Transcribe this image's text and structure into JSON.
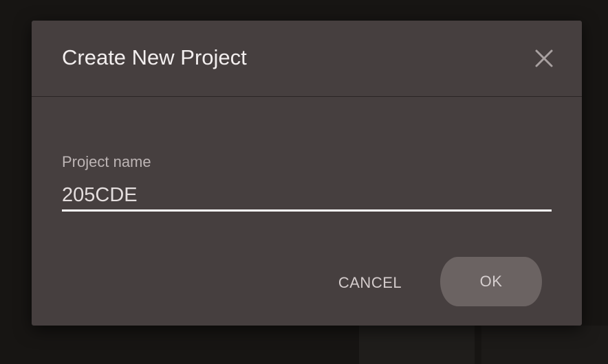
{
  "dialog": {
    "title": "Create New Project",
    "close_icon": "close-icon",
    "field": {
      "label": "Project name",
      "value": "205CDE"
    },
    "buttons": {
      "cancel_label": "CANCEL",
      "ok_label": "OK"
    }
  },
  "colors": {
    "dialog_background": "#463f3f",
    "ok_button_background": "#6b6362",
    "input_underline": "#ffffff"
  }
}
